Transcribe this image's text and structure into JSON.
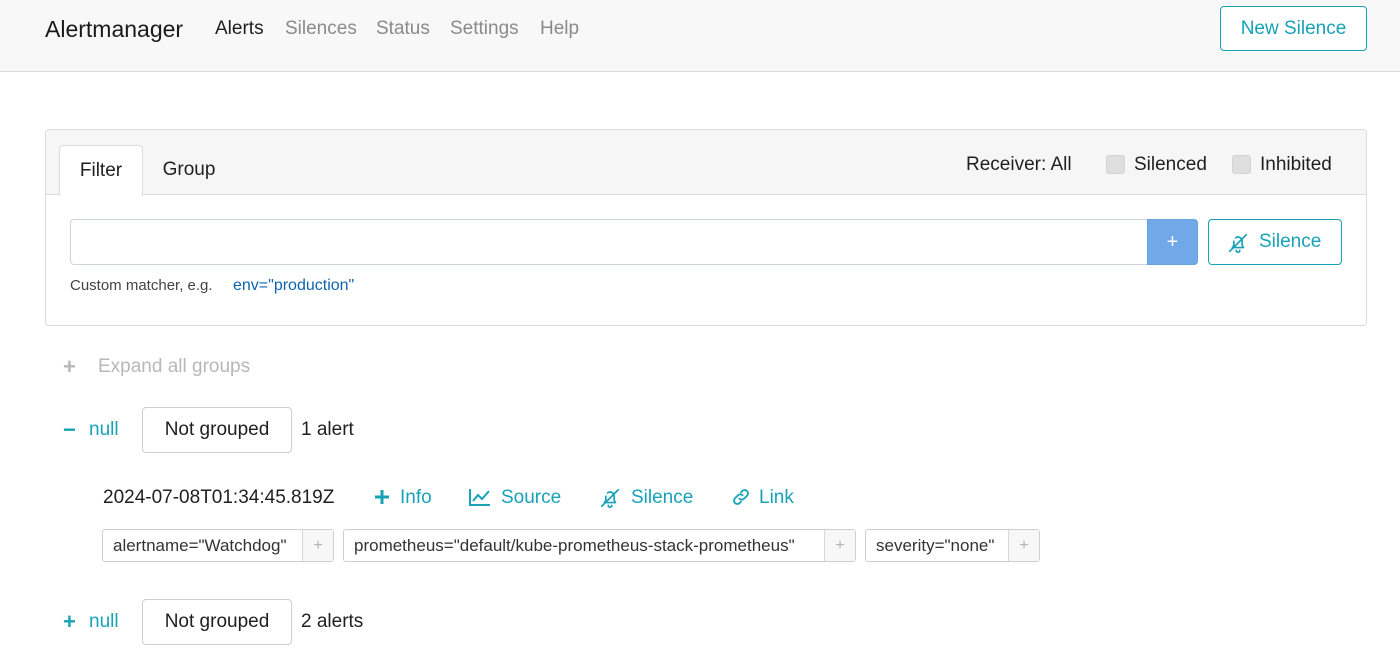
{
  "navbar": {
    "brand": "Alertmanager",
    "links": [
      "Alerts",
      "Silences",
      "Status",
      "Settings",
      "Help"
    ],
    "new_silence_label": "New Silence"
  },
  "filter_card": {
    "tabs": [
      "Filter",
      "Group"
    ],
    "receiver_label": "Receiver: All",
    "silenced_label": "Silenced",
    "inhibited_label": "Inhibited",
    "input_value": "",
    "add_button_label": "+",
    "silence_button_label": "Silence",
    "hint_text": "Custom matcher, e.g.",
    "hint_example": "env=\"production\""
  },
  "expand_all_label": "Expand all groups",
  "groups": [
    {
      "toggle_sign": "−",
      "name": "null",
      "group_label": "Not grouped",
      "count_label": "1 alert",
      "alert": {
        "timestamp": "2024-07-08T01:34:45.819Z",
        "actions": [
          "Info",
          "Source",
          "Silence",
          "Link"
        ],
        "labels": [
          "alertname=\"Watchdog\"",
          "prometheus=\"default/kube-prometheus-stack-prometheus\"",
          "severity=\"none\""
        ],
        "label_add": "+"
      }
    },
    {
      "toggle_sign": "+",
      "name": "null",
      "group_label": "Not grouped",
      "count_label": "2 alerts"
    }
  ],
  "colors": {
    "accent": "#17a2b8",
    "add_button": "#71a8e7",
    "link_blue": "#0d64b0"
  }
}
